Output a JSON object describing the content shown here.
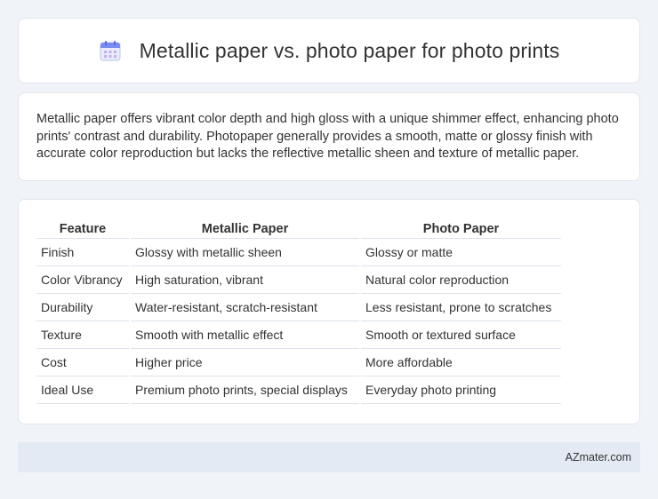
{
  "header": {
    "icon": "calendar-icon",
    "title": "Metallic paper vs. photo paper for photo prints"
  },
  "intro": {
    "text": "Metallic paper offers vibrant color depth and high gloss with a unique shimmer effect, enhancing photo prints' contrast and durability. Photopaper generally provides a smooth, matte or glossy finish with accurate color reproduction but lacks the reflective metallic sheen and texture of metallic paper."
  },
  "table": {
    "headers": [
      "Feature",
      "Metallic Paper",
      "Photo Paper"
    ],
    "rows": [
      [
        "Finish",
        "Glossy with metallic sheen",
        "Glossy or matte"
      ],
      [
        "Color Vibrancy",
        "High saturation, vibrant",
        "Natural color reproduction"
      ],
      [
        "Durability",
        "Water-resistant, scratch-resistant",
        "Less resistant, prone to scratches"
      ],
      [
        "Texture",
        "Smooth with metallic effect",
        "Smooth or textured surface"
      ],
      [
        "Cost",
        "Higher price",
        "More affordable"
      ],
      [
        "Ideal Use",
        "Premium photo prints, special displays",
        "Everyday photo printing"
      ]
    ]
  },
  "footer": {
    "site": "AZmater.com"
  },
  "colors": {
    "background": "#f0f3f8",
    "card": "#ffffff",
    "footer": "#e4eaf4",
    "icon_accent": "#7b8cf0"
  }
}
